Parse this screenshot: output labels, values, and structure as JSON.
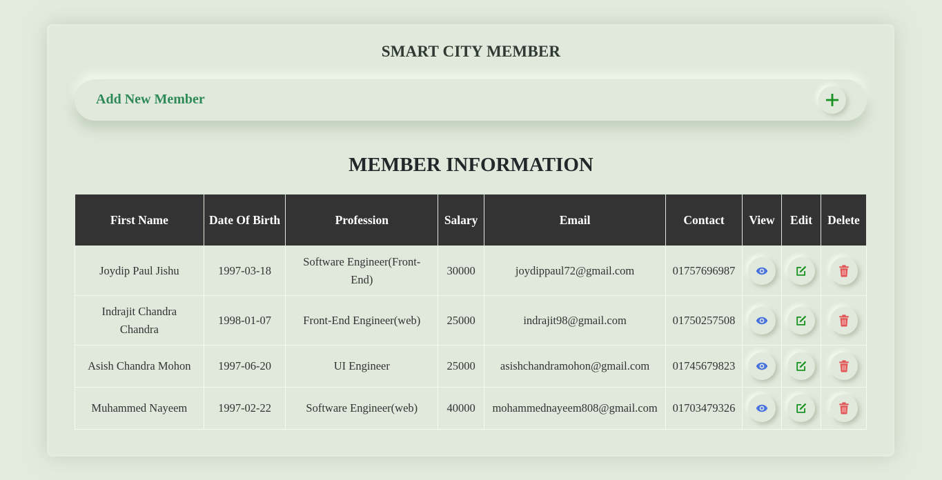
{
  "header": {
    "title": "SMART CITY MEMBER"
  },
  "add_member": {
    "label": "Add New Member",
    "icon": "plus-icon",
    "color": "#2d8a57"
  },
  "section": {
    "title": "MEMBER INFORMATION"
  },
  "table": {
    "columns": [
      "First Name",
      "Date Of Birth",
      "Profession",
      "Salary",
      "Email",
      "Contact",
      "View",
      "Edit",
      "Delete"
    ],
    "rows": [
      {
        "first_name": "Joydip Paul Jishu",
        "dob": "1997-03-18",
        "profession": "Software Engineer(Front-End)",
        "salary": "30000",
        "email": "joydippaul72@gmail.com",
        "contact": "01757696987"
      },
      {
        "first_name": "Indrajit Chandra Chandra",
        "dob": "1998-01-07",
        "profession": "Front-End Engineer(web)",
        "salary": "25000",
        "email": "indrajit98@gmail.com",
        "contact": "01750257508"
      },
      {
        "first_name": "Asish Chandra Mohon",
        "dob": "1997-06-20",
        "profession": "UI Engineer",
        "salary": "25000",
        "email": "asishchandramohon@gmail.com",
        "contact": "01745679823"
      },
      {
        "first_name": "Muhammed Nayeem",
        "dob": "1997-02-22",
        "profession": "Software Engineer(web)",
        "salary": "40000",
        "email": "mohammednayeem808@gmail.com",
        "contact": "01703479326"
      }
    ],
    "row_icons": {
      "view": "eye-icon",
      "edit": "edit-icon",
      "delete": "trash-icon"
    },
    "icon_colors": {
      "view": "#4a73e0",
      "edit": "#17911f",
      "delete": "#e05555"
    },
    "header_bg": "#333333"
  }
}
